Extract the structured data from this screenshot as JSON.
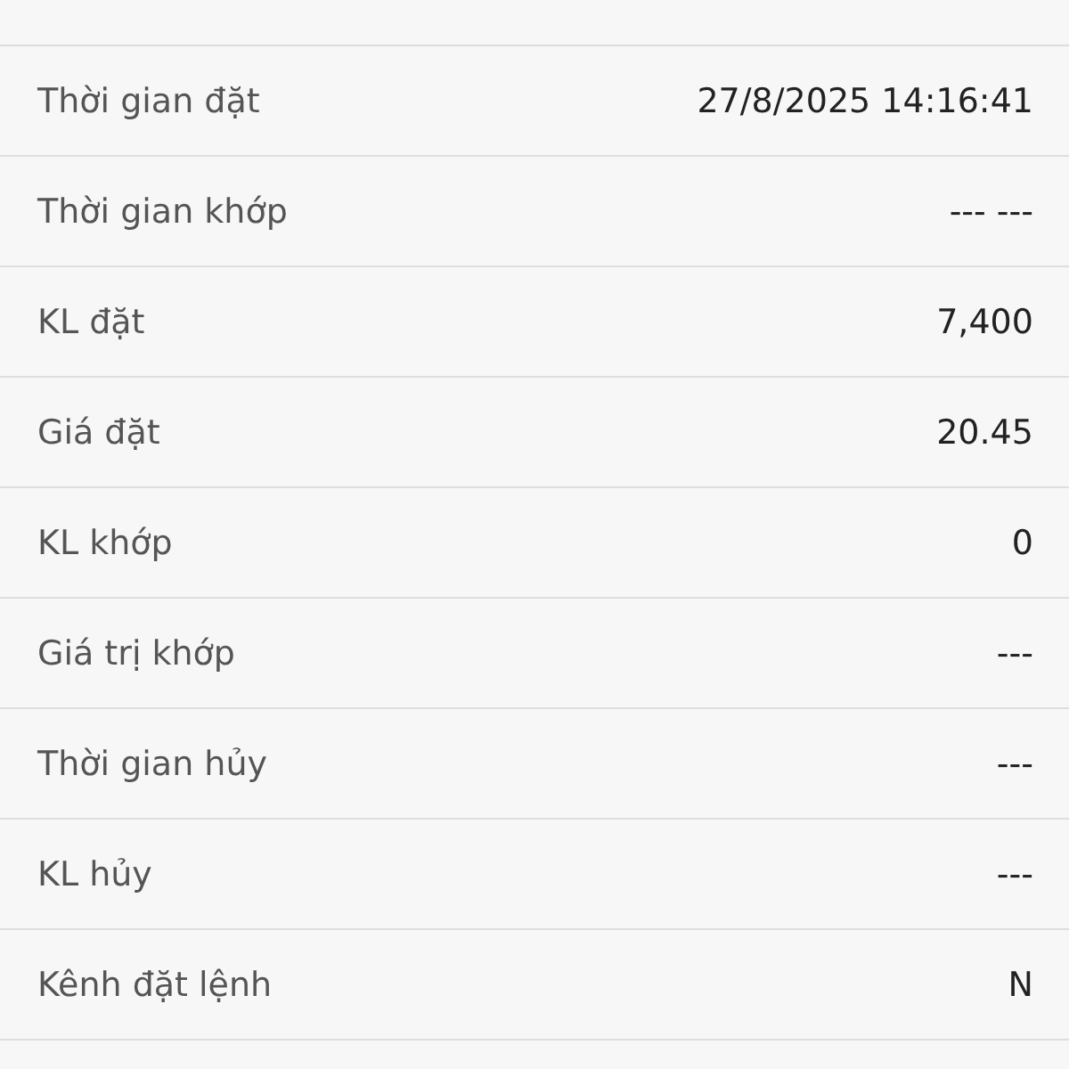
{
  "rows": [
    {
      "label": "Thời gian đặt",
      "value": "27/8/2025 14:16:41"
    },
    {
      "label": "Thời gian khớp",
      "value": "--- ---"
    },
    {
      "label": "KL đặt",
      "value": "7,400"
    },
    {
      "label": "Giá đặt",
      "value": "20.45"
    },
    {
      "label": "KL khớp",
      "value": "0"
    },
    {
      "label": "Giá trị khớp",
      "value": "---"
    },
    {
      "label": "Thời gian hủy",
      "value": "---"
    },
    {
      "label": "KL hủy",
      "value": "---"
    },
    {
      "label": "Kênh đặt lệnh",
      "value": "N"
    }
  ]
}
